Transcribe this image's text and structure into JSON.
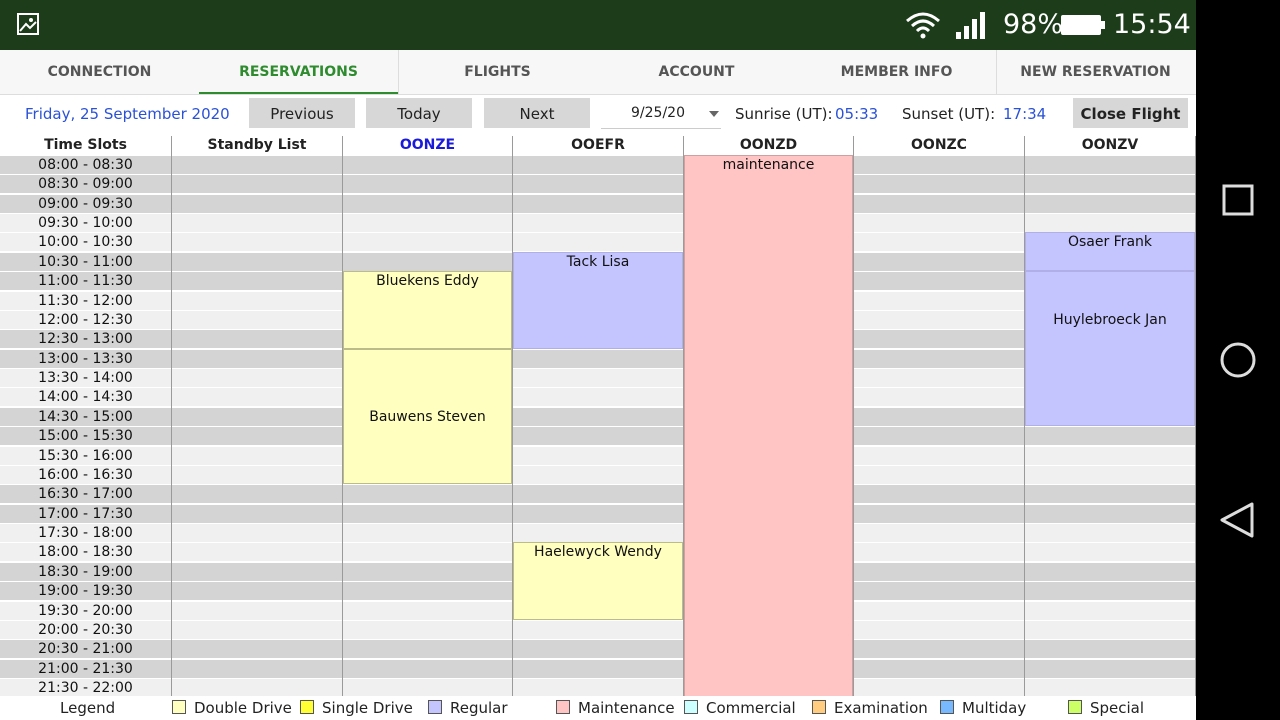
{
  "status_bar": {
    "battery": "98%",
    "time": "15:54"
  },
  "tabs": [
    {
      "label": "CONNECTION",
      "active": false
    },
    {
      "label": "RESERVATIONS",
      "active": true
    },
    {
      "label": "FLIGHTS",
      "active": false
    },
    {
      "label": "ACCOUNT",
      "active": false
    },
    {
      "label": "MEMBER INFO",
      "active": false
    },
    {
      "label": "NEW RESERVATION",
      "active": false
    }
  ],
  "toolbar": {
    "date_text": "Friday, 25 September 2020",
    "previous_label": "Previous",
    "today_label": "Today",
    "next_label": "Next",
    "date_value": "9/25/20",
    "sunrise_label": "Sunrise (UT):",
    "sunrise_value": "05:33",
    "sunset_label": "Sunset (UT):",
    "sunset_value": "17:34",
    "close_flight_label": "Close Flight"
  },
  "schedule": {
    "columns": [
      "Time Slots",
      "Standby List",
      "OONZE",
      "OOEFR",
      "OONZD",
      "OONZC",
      "OONZV"
    ],
    "highlighted_column": "OONZE",
    "time_slots": [
      "08:00 - 08:30",
      "08:30 - 09:00",
      "09:00 - 09:30",
      "09:30 - 10:00",
      "10:00 - 10:30",
      "10:30 - 11:00",
      "11:00 - 11:30",
      "11:30 - 12:00",
      "12:00 - 12:30",
      "12:30 - 13:00",
      "13:00 - 13:30",
      "13:30 - 14:00",
      "14:00 - 14:30",
      "14:30 - 15:00",
      "15:00 - 15:30",
      "15:30 - 16:00",
      "16:00 - 16:30",
      "16:30 - 17:00",
      "17:00 - 17:30",
      "17:30 - 18:00",
      "18:00 - 18:30",
      "18:30 - 19:00",
      "19:00 - 19:30",
      "19:30 - 20:00",
      "20:00 - 20:30",
      "20:30 - 21:00",
      "21:00 - 21:30",
      "21:30 - 22:00"
    ],
    "reservations": [
      {
        "column": "OONZE",
        "name": "Bluekens Eddy",
        "type": "Double Drive",
        "start": "11:00",
        "end": "13:00",
        "label_slot": "11:00"
      },
      {
        "column": "OONZE",
        "name": "Bauwens Steven",
        "type": "Double Drive",
        "start": "13:00",
        "end": "16:30",
        "label_slot": "14:30"
      },
      {
        "column": "OOEFR",
        "name": "Tack Lisa",
        "type": "Regular",
        "start": "10:30",
        "end": "13:00",
        "label_slot": "10:30"
      },
      {
        "column": "OOEFR",
        "name": "Haelewyck Wendy",
        "type": "Double Drive",
        "start": "18:00",
        "end": "20:00",
        "label_slot": "18:00"
      },
      {
        "column": "OONZD",
        "name": "maintenance",
        "type": "Maintenance",
        "start": "08:00",
        "end": "22:00",
        "label_slot": "08:00"
      },
      {
        "column": "OONZV",
        "name": "Osaer Frank",
        "type": "Regular",
        "start": "10:00",
        "end": "11:00",
        "label_slot": "10:00"
      },
      {
        "column": "OONZV",
        "name": "Huylebroeck Jan",
        "type": "Regular",
        "start": "11:00",
        "end": "15:00",
        "label_slot": "12:00"
      }
    ]
  },
  "legend": {
    "title": "Legend",
    "items": [
      {
        "label": "Double Drive",
        "color": "#ffffc0"
      },
      {
        "label": "Single Drive",
        "color": "#ffff33"
      },
      {
        "label": "Regular",
        "color": "#c4c4ff"
      },
      {
        "label": "Maintenance",
        "color": "#ffc4c4"
      },
      {
        "label": "Commercial",
        "color": "#ccffff"
      },
      {
        "label": "Examination",
        "color": "#ffcc80"
      },
      {
        "label": "Multiday",
        "color": "#77b8ff"
      },
      {
        "label": "Special",
        "color": "#ccff66"
      }
    ]
  },
  "colors": {
    "status_bar": "#1d3d1a",
    "accent_green": "#2e8b2e",
    "link_blue": "#2a52d6"
  }
}
